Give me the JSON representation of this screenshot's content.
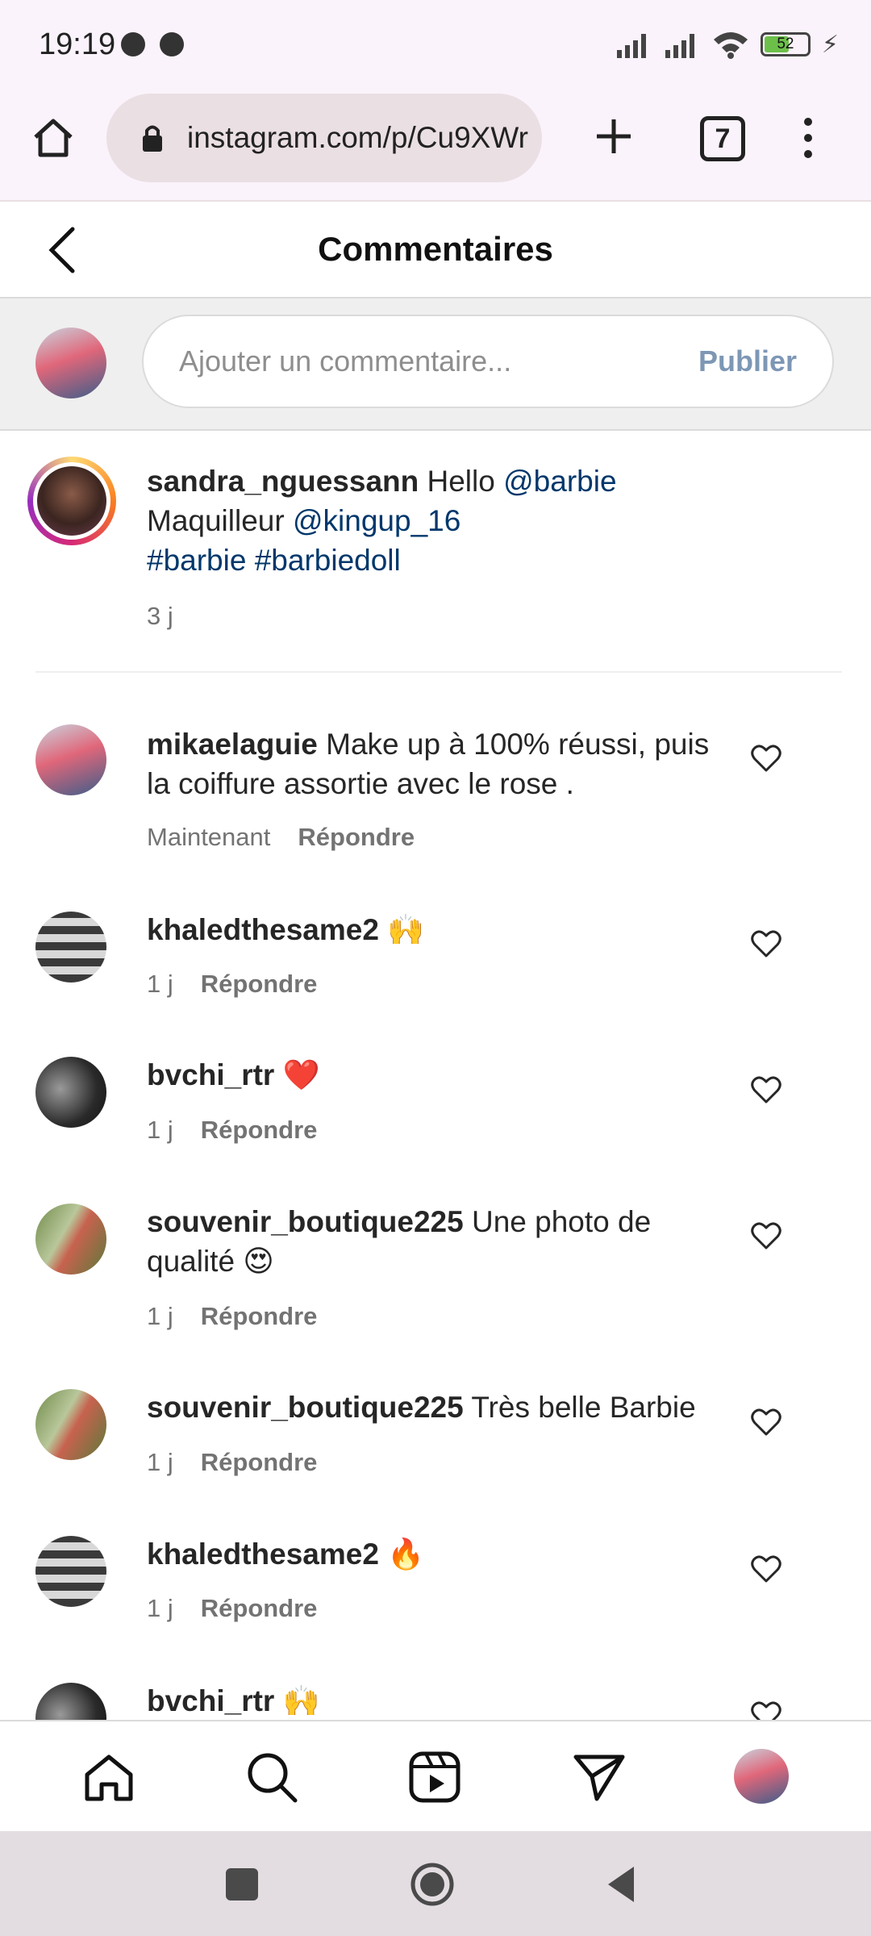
{
  "status_bar": {
    "time": "19:19",
    "battery": "52"
  },
  "browser": {
    "url": "instagram.com/p/Cu9XWr",
    "tab_count": "7"
  },
  "header": {
    "title": "Commentaires"
  },
  "add_comment": {
    "placeholder": "Ajouter un commentaire...",
    "publish_label": "Publier"
  },
  "caption": {
    "username": "sandra_nguessann",
    "text_1": " Hello ",
    "mention_1": "@barbie",
    "text_2": "Maquilleur ",
    "mention_2": "@kingup_16",
    "hashtag_1": "#barbie",
    "hashtag_2": "#barbiedoll",
    "time": "3 j"
  },
  "reply_label": "Répondre",
  "comments": [
    {
      "username": "mikaelaguie",
      "text": " Make up à 100% réussi, puis la coiffure assortie avec le rose .",
      "time": "Maintenant"
    },
    {
      "username": "khaledthesame2",
      "text": " 🙌",
      "time": "1 j"
    },
    {
      "username": "bvchi_rtr",
      "text": " ❤️",
      "time": "1 j"
    },
    {
      "username": "souvenir_boutique225",
      "text": " Une photo de qualité 😍",
      "time": "1 j"
    },
    {
      "username": "souvenir_boutique225",
      "text": " Très belle Barbie",
      "time": "1 j"
    },
    {
      "username": "khaledthesame2",
      "text": " 🔥",
      "time": "1 j"
    },
    {
      "username": "bvchi_rtr",
      "text": " 🙌"
    }
  ]
}
